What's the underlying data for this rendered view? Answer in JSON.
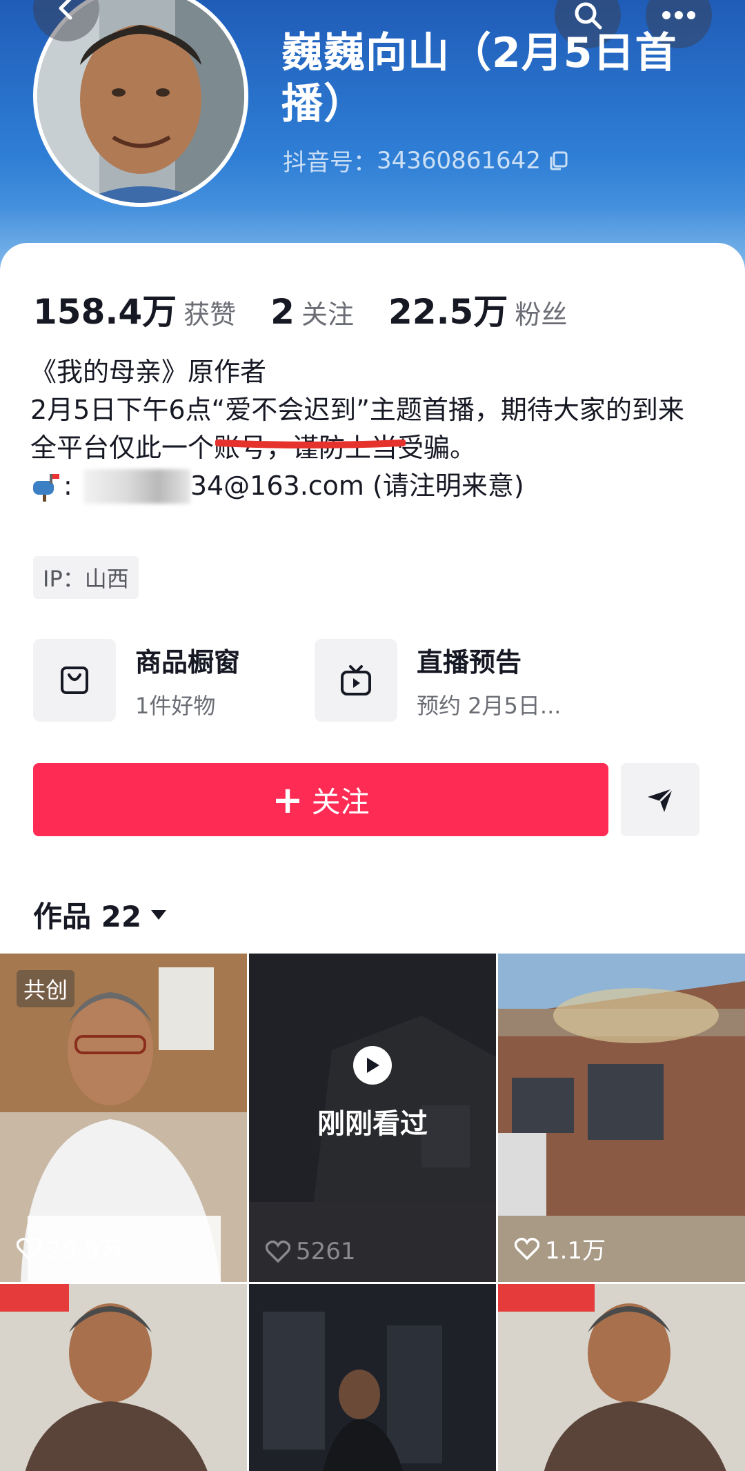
{
  "header": {
    "title": "巍巍向山（2月5日首播）",
    "douyin_id_label": "抖音号：",
    "douyin_id": "34360861642"
  },
  "stats": [
    {
      "value": "158.4万",
      "label": "获赞"
    },
    {
      "value": "2",
      "label": "关注"
    },
    {
      "value": "22.5万",
      "label": "粉丝"
    }
  ],
  "bio": {
    "line1": "《我的母亲》原作者",
    "line2": "2月5日下午6点“爱不会迟到”主题首播，期待大家的到来",
    "line3": "全平台仅此一个账号，谨防上当受骗。",
    "mail_visible": "34@163.com (请注明来意)"
  },
  "ip": "IP：山西",
  "features": [
    {
      "title": "商品橱窗",
      "subtitle": "1件好物",
      "icon": "bag-icon"
    },
    {
      "title": "直播预告",
      "subtitle": "预约 2月5日...",
      "icon": "live-tv-icon"
    }
  ],
  "follow_label": "关注",
  "works_label": "作品 22",
  "grid": {
    "badge": "共创",
    "watched": "刚刚看过",
    "items": [
      {
        "likes": "29.9万"
      },
      {
        "likes": "5261"
      },
      {
        "likes": "1.1万"
      }
    ]
  },
  "colors": {
    "accent": "#fe2c55",
    "header": "#2f7fd6"
  }
}
